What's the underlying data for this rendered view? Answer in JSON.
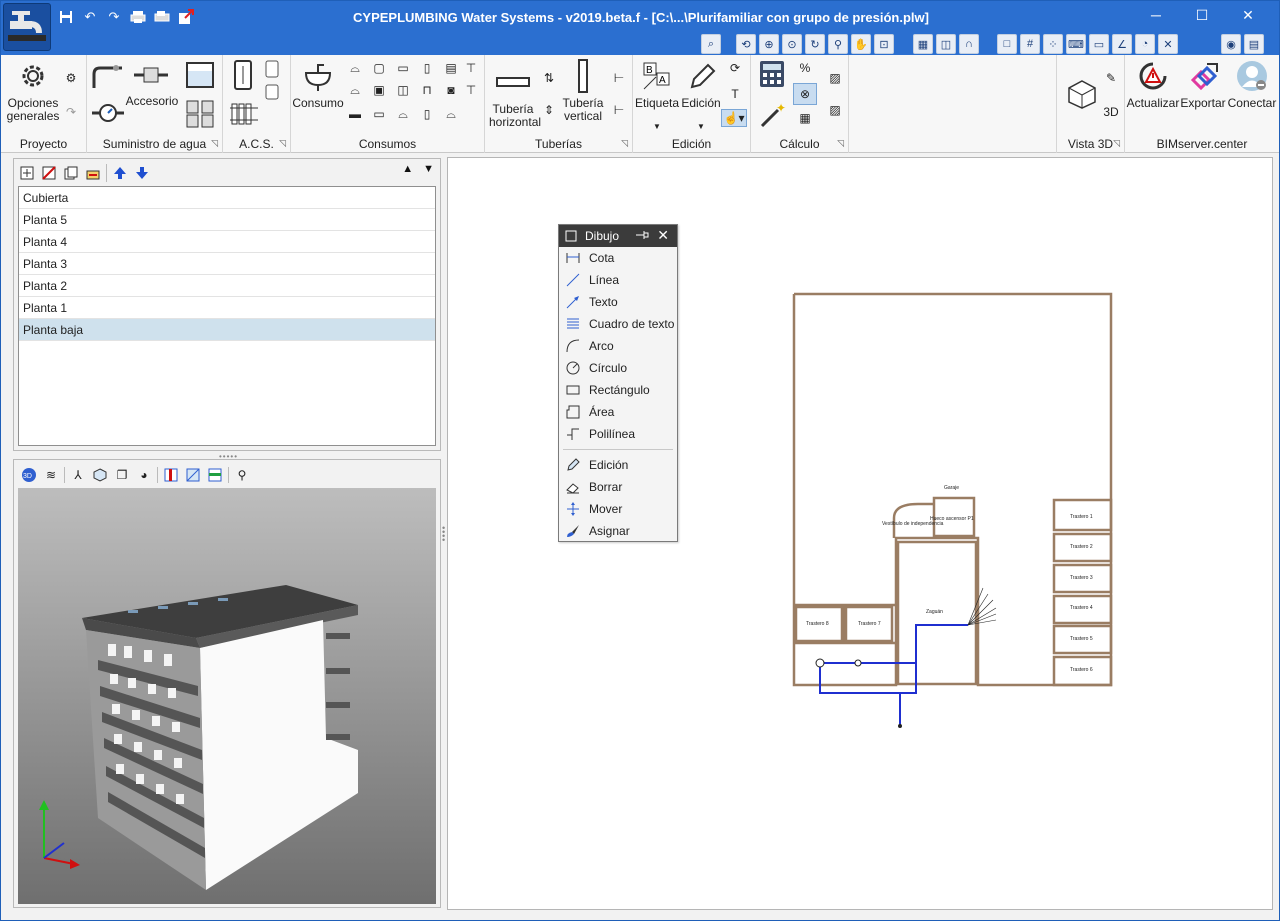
{
  "window": {
    "title": "CYPEPLUMBING Water Systems - v2019.beta.f - [C:\\...\\Plurifamiliar con grupo de presión.plw]",
    "controls": {
      "minimize": "─",
      "maximize": "☐",
      "close": "✕"
    }
  },
  "quick_access": [
    "save-icon",
    "undo-icon",
    "redo-icon",
    "print-icon",
    "print-setup-icon",
    "export-icon"
  ],
  "ribbon": {
    "groups": [
      {
        "label": "Proyecto",
        "buttons": [
          {
            "label": "Opciones generales"
          }
        ]
      },
      {
        "label": "Suministro de agua",
        "buttons": [
          {
            "label": "Accesorio"
          }
        ]
      },
      {
        "label": "A.C.S.",
        "buttons": []
      },
      {
        "label": "Consumos",
        "buttons": [
          {
            "label": "Consumo"
          }
        ]
      },
      {
        "label": "Tuberías",
        "buttons": [
          {
            "label": "Tubería horizontal"
          },
          {
            "label": "Tubería vertical"
          }
        ]
      },
      {
        "label": "Edición",
        "buttons": [
          {
            "label": "Etiqueta"
          },
          {
            "label": "Edición"
          }
        ]
      },
      {
        "label": "Cálculo",
        "buttons": []
      },
      {
        "label": "Vista 3D",
        "buttons": []
      },
      {
        "label": "BIMserver.center",
        "buttons": [
          {
            "label": "Actualizar"
          },
          {
            "label": "Exportar"
          },
          {
            "label": "Conectar"
          }
        ]
      }
    ]
  },
  "levels": {
    "items": [
      "Cubierta",
      "Planta 5",
      "Planta 4",
      "Planta 3",
      "Planta 2",
      "Planta 1",
      "Planta baja"
    ],
    "selected": "Planta baja"
  },
  "dibujo_panel": {
    "title": "Dibujo",
    "items": [
      "Cota",
      "Línea",
      "Texto",
      "Cuadro de texto",
      "Arco",
      "Círculo",
      "Rectángulo",
      "Área",
      "Polilínea"
    ],
    "edit_items": [
      "Edición",
      "Borrar",
      "Mover",
      "Asignar"
    ]
  },
  "plan": {
    "rooms": [
      "Garaje",
      "Hueco ascensor P1",
      "Vestíbulo de independencia",
      "Zaguán",
      "Trastero 1",
      "Trastero 2",
      "Trastero 3",
      "Trastero 4",
      "Trastero 5",
      "Trastero 6",
      "Trastero 7",
      "Trastero 8"
    ]
  },
  "colors": {
    "titlebar": "#2b6fd0",
    "selection": "#cfe1ed",
    "plan_walls": "#9a7d63",
    "pipes": "#1f2fd0"
  }
}
